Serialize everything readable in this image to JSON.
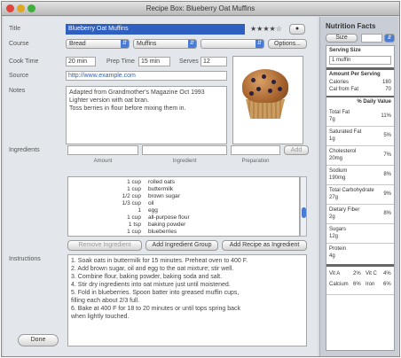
{
  "window": {
    "title": "Recipe Box: Blueberry Oat Muffins"
  },
  "recipe": {
    "title_label": "Title",
    "title_value": "Blueberry Oat Muffins",
    "rating": "★★★★☆",
    "course_label": "Course",
    "course_value": "Bread",
    "category_value": "Muffins",
    "cuisine_value": "",
    "options_button": "Options...",
    "cook_time_label": "Cook Time",
    "cook_time_value": "20 min",
    "prep_time_label": "Prep Time",
    "prep_time_value": "15 min",
    "serves_label": "Serves",
    "serves_value": "12",
    "source_label": "Source",
    "source_value": "http://www.example.com",
    "notes_label": "Notes",
    "notes_lines": [
      "Adapted from Grandmother's Magazine Oct 1993",
      "Lighter version with oat bran.",
      "Toss berries in flour before mixing them in."
    ]
  },
  "ingredients": {
    "label": "Ingredients",
    "col_amount": "Amount",
    "col_ingredient": "Ingredient",
    "col_preparation": "Preparation",
    "add_button": "Add",
    "rows": [
      {
        "amount": "1 cup",
        "name": "rolled oats"
      },
      {
        "amount": "1 cup",
        "name": "buttermilk"
      },
      {
        "amount": "1/2 cup",
        "name": "brown sugar"
      },
      {
        "amount": "1/3 cup",
        "name": "oil"
      },
      {
        "amount": "1",
        "name": "egg"
      },
      {
        "amount": "1 cup",
        "name": "all-purpose flour"
      },
      {
        "amount": "1 tsp",
        "name": "baking powder"
      },
      {
        "amount": "1 cup",
        "name": "blueberries"
      }
    ],
    "remove_button": "Remove Ingredient",
    "add_group_button": "Add Ingredient Group",
    "add_recipe_button": "Add Recipe as Ingredient"
  },
  "instructions": {
    "label": "Instructions",
    "lines": [
      "1. Soak oats in buttermilk for 15 minutes. Preheat oven to 400 F.",
      "2. Add brown sugar, oil and egg to the oat mixture; stir well.",
      "3. Combine flour, baking powder, baking soda and salt.",
      "4. Stir dry ingredients into oat mixture just until moistened.",
      "5. Fold in blueberries. Spoon batter into greased muffin cups,",
      "   filling each about 2/3 full.",
      "6. Bake at 400 F for 18 to 20 minutes or until tops spring back",
      "   when lightly touched."
    ]
  },
  "footer": {
    "done_button": "Done"
  },
  "nutrition": {
    "title": "Nutrition Facts",
    "size_button": "Size",
    "serving_size_label": "Serving Size",
    "serving_size_value": "1 muffin",
    "amount_per_serving": "Amount Per Serving",
    "calories_label": "Calories",
    "calories_value": "180",
    "cal_fat_label": "Cal from Fat",
    "cal_fat_value": "70",
    "daily_value": "% Daily Value",
    "rows": [
      {
        "name": "Total Fat",
        "amount": "7g",
        "pct": "11%"
      },
      {
        "name": "Saturated Fat",
        "amount": "1g",
        "pct": "5%"
      },
      {
        "name": "Cholesterol",
        "amount": "20mg",
        "pct": "7%"
      },
      {
        "name": "Sodium",
        "amount": "190mg",
        "pct": "8%"
      },
      {
        "name": "Total Carbohydrate",
        "amount": "27g",
        "pct": "9%"
      },
      {
        "name": "Dietary Fiber",
        "amount": "2g",
        "pct": "8%"
      },
      {
        "name": "Sugars",
        "amount": "12g",
        "pct": ""
      },
      {
        "name": "Protein",
        "amount": "4g",
        "pct": ""
      }
    ],
    "vitamins": [
      {
        "name": "Vit A",
        "pct": "2%"
      },
      {
        "name": "Vit C",
        "pct": "4%"
      },
      {
        "name": "Calcium",
        "pct": "6%"
      },
      {
        "name": "Iron",
        "pct": "6%"
      }
    ]
  },
  "colors": {
    "accent": "#4a7bd4",
    "title_highlight": "#2f5fbf"
  },
  "icons": {
    "close": "close-icon",
    "minimize": "minimize-icon",
    "zoom": "zoom-icon",
    "popup": "chevron-updown-icon"
  }
}
